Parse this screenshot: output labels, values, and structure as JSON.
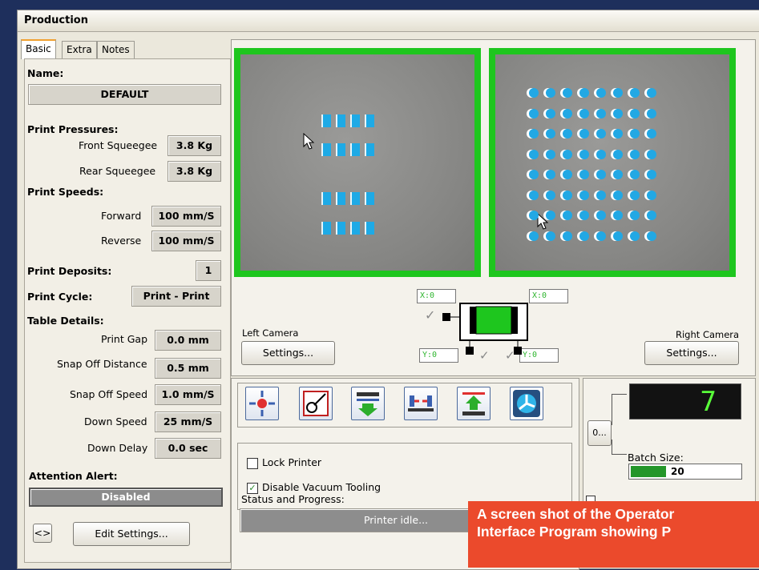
{
  "window": {
    "title": "Production"
  },
  "tabs": [
    "Basic",
    "Extra",
    "Notes"
  ],
  "name": {
    "label": "Name:",
    "value": "DEFAULT"
  },
  "pressures": {
    "label": "Print Pressures:",
    "front_label": "Front Squeegee",
    "front_value": "3.8 Kg",
    "rear_label": "Rear Squeegee",
    "rear_value": "3.8 Kg"
  },
  "speeds": {
    "label": "Print Speeds:",
    "forward_label": "Forward",
    "forward_value": "100 mm/S",
    "reverse_label": "Reverse",
    "reverse_value": "100 mm/S"
  },
  "deposits": {
    "label": "Print Deposits:",
    "value": "1"
  },
  "cycle": {
    "label": "Print Cycle:",
    "value": "Print - Print"
  },
  "table": {
    "label": "Table Details:",
    "print_gap_label": "Print Gap",
    "print_gap_value": "0.0 mm",
    "snap_dist_label": "Snap Off Distance",
    "snap_dist_value": "0.5 mm",
    "snap_speed_label": "Snap Off Speed",
    "snap_speed_value": "1.0 mm/S",
    "down_speed_label": "Down Speed",
    "down_speed_value": "25 mm/S",
    "down_delay_label": "Down Delay",
    "down_delay_value": "0.0 sec"
  },
  "alert": {
    "label": "Attention Alert:",
    "value": "Disabled"
  },
  "buttons": {
    "toggle": "<>",
    "edit": "Edit Settings...",
    "left_settings": "Settings...",
    "right_settings": "Settings...",
    "batch_reset": "0..."
  },
  "cameras": {
    "left_label": "Left Camera",
    "right_label": "Right Camera"
  },
  "coords": {
    "x_left": "X:0",
    "x_right": "X:0",
    "y_left": "Y:0",
    "y_right": "Y:0"
  },
  "toolbar_icons": [
    "align-target-icon",
    "squeegee-icon",
    "load-board-icon",
    "stencil-align-icon",
    "unload-board-icon",
    "fan-icon"
  ],
  "options": {
    "lock_printer": "Lock Printer",
    "disable_vacuum": "Disable Vacuum Tooling"
  },
  "status": {
    "label": "Status and Progress:",
    "value": "Printer idle..."
  },
  "counter": {
    "display": "7",
    "batch_label": "Batch Size:",
    "batch_value": "20"
  },
  "caption": {
    "line1": "A screen shot of the Operator",
    "line2": "Interface Program showing P"
  },
  "colors": {
    "camera_frame": "#1ec61e",
    "pad_blue": "#1eaae6",
    "caption_bg": "#eb4a2c",
    "led_green": "#59ff3a"
  }
}
